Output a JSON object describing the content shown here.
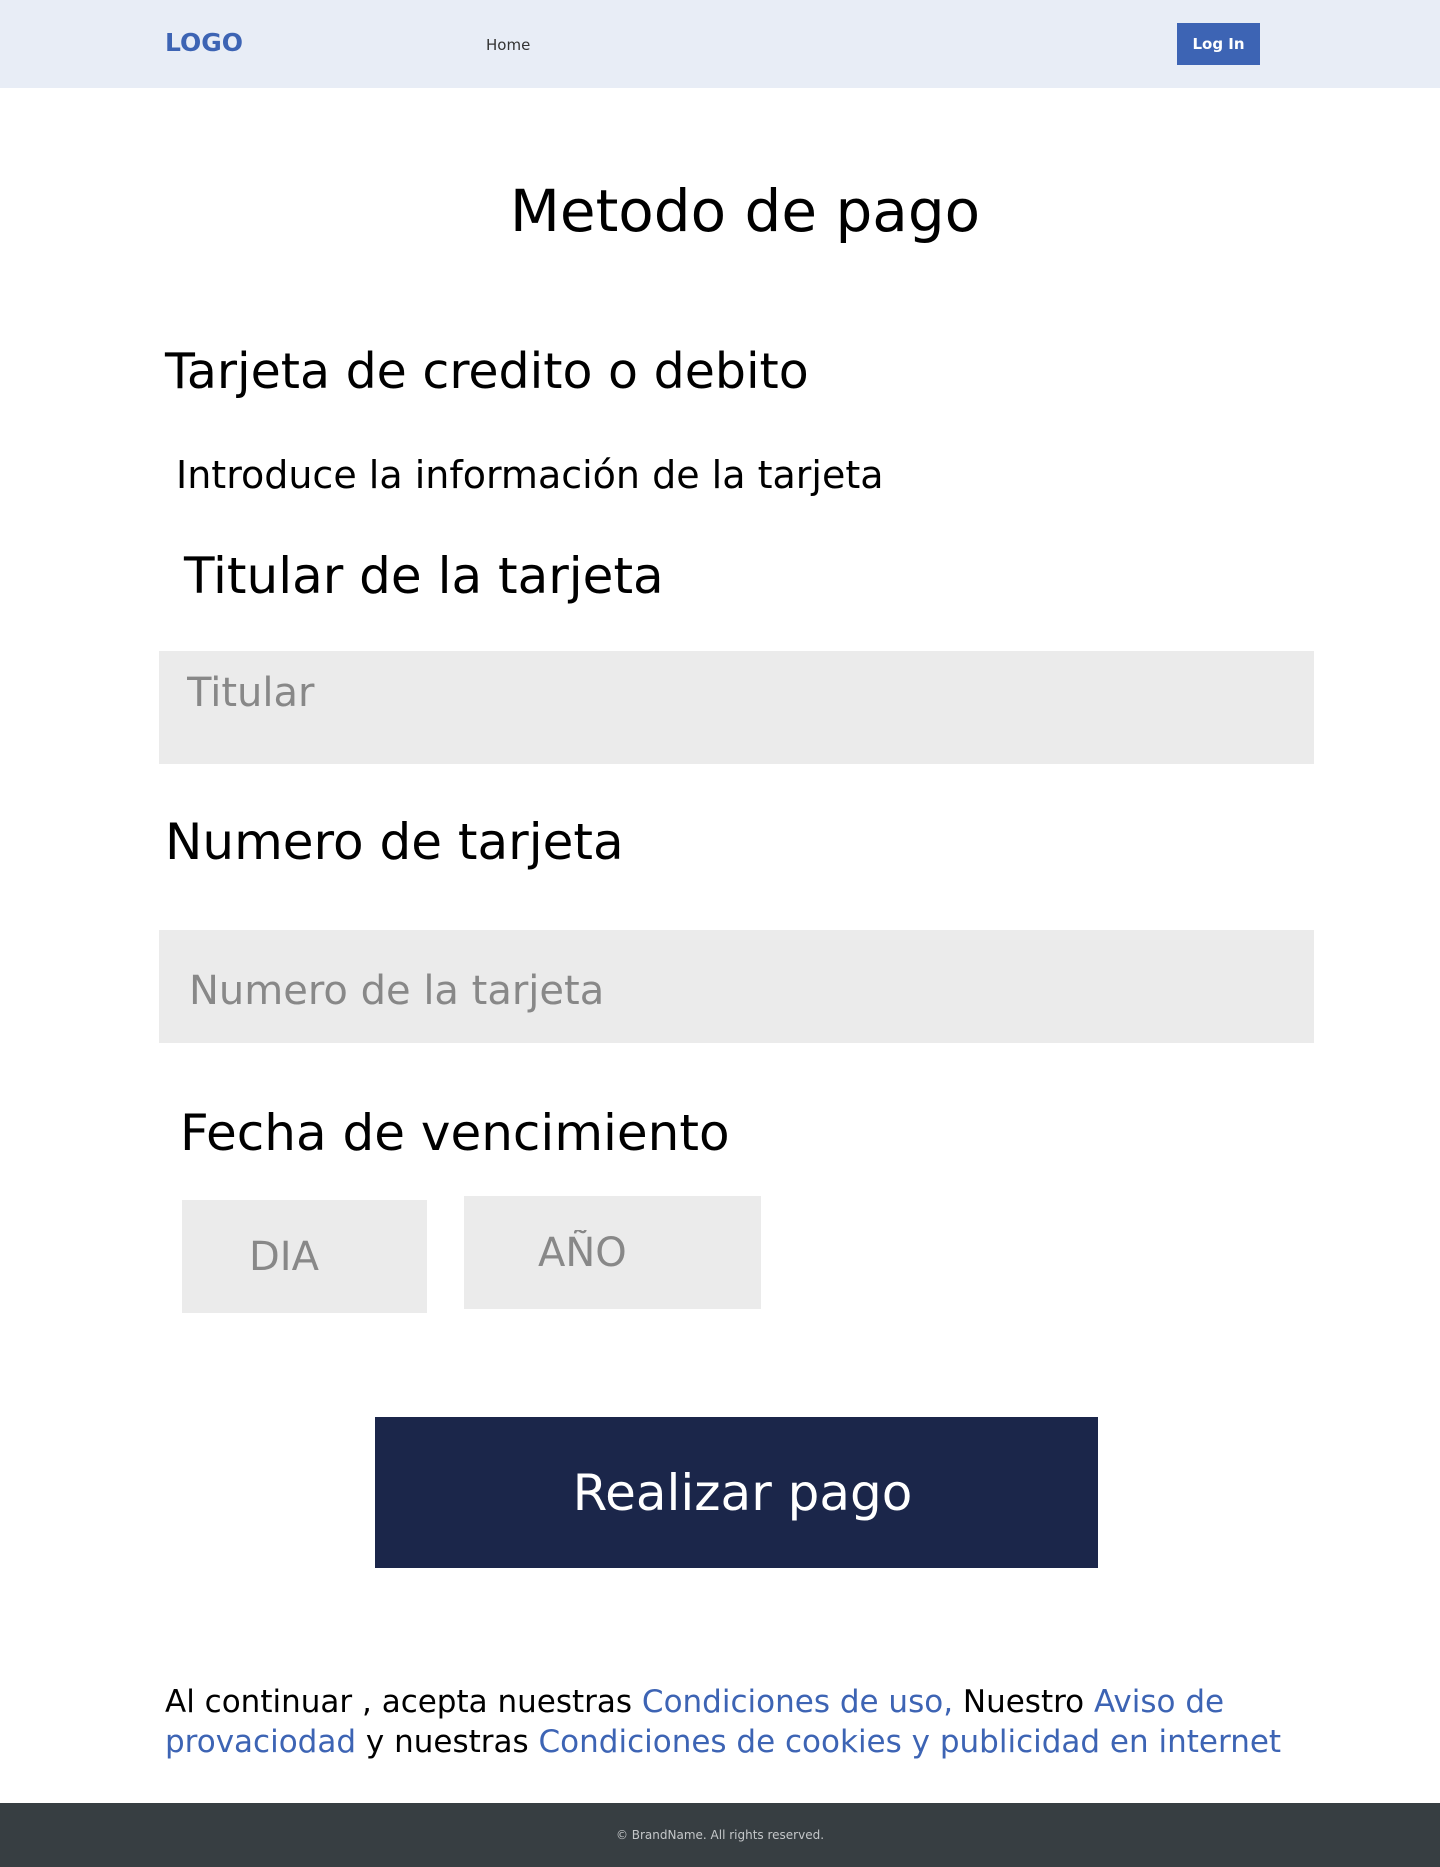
{
  "header": {
    "logo": "LOGO",
    "nav_home": "Home",
    "login_label": "Log In"
  },
  "main": {
    "title": "Metodo de pago",
    "section_title": "Tarjeta de credito o debito",
    "section_subtitle": "Introduce la información de la tarjeta",
    "holder_label": "Titular de la tarjeta",
    "holder_placeholder": "Titular",
    "number_label": "Numero de tarjeta",
    "number_placeholder": "Numero de la tarjeta",
    "expiry_label": "Fecha de vencimiento",
    "day_placeholder": "DIA",
    "year_placeholder": "AÑO",
    "pay_label": "Realizar pago"
  },
  "terms": {
    "part1": "Al continuar , acepta  nuestras ",
    "link_conditions": "Condiciones de uso,",
    "part2": " Nuestro ",
    "link_privacy": "Aviso de provaciodad",
    "part3": " y  nuestras ",
    "link_cookies": "Condiciones de cookies y publicidad en internet"
  },
  "footer": {
    "copyright": "© BrandName. All rights reserved."
  },
  "colors": {
    "header_bg": "#e8edf6",
    "brand_blue": "#3d64b4",
    "pay_button_bg": "#1b264a",
    "input_bg": "#ebebeb",
    "footer_bg": "#373e42"
  }
}
